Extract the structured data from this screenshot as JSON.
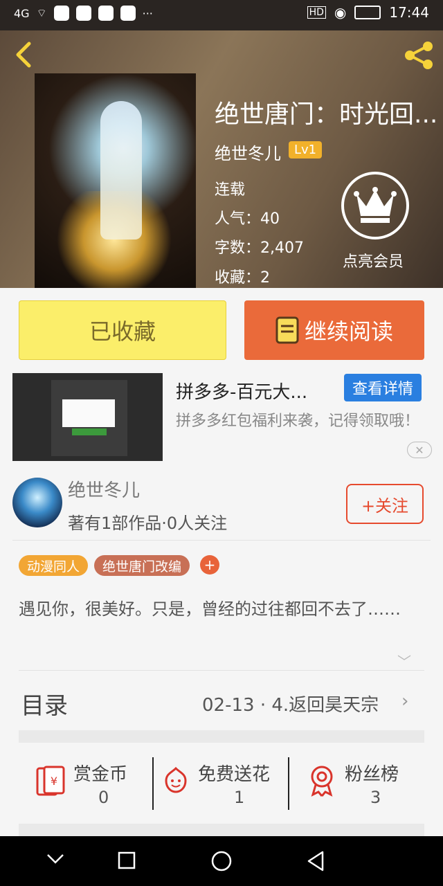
{
  "status_bar": {
    "signal": "4G",
    "time": "17:44",
    "hd": "HD",
    "more": "···"
  },
  "header": {
    "back_icon": "chevron-left-icon",
    "share_icon": "share-icon",
    "title": "绝世唐门：时光回...",
    "author": "绝世冬儿",
    "level": "Lv1",
    "status": "连载",
    "popularity": "人气：40",
    "word_count": "字数：2,407",
    "favorites": "收藏：2",
    "member_label": "点亮会员"
  },
  "actions": {
    "favorited": "已收藏",
    "continue_reading": "继续阅读"
  },
  "ad": {
    "title": "拼多多-百元大...",
    "detail_button": "查看详情",
    "description": "拼多多红包福利来袭，记得领取哦！",
    "close": "✕"
  },
  "author_card": {
    "name": "绝世冬儿",
    "stats": "著有1部作品·0人关注",
    "follow": "+关注"
  },
  "tags": [
    {
      "label": "动漫同人",
      "color": "#f2a634"
    },
    {
      "label": "绝世唐门改编",
      "color": "#c87056"
    }
  ],
  "tag_add": "+",
  "description": "遇见你，很美好。只是，曾经的过往都回不去了……",
  "toc": {
    "label": "目录",
    "latest": "02-13 · 4.返回昊天宗"
  },
  "stats": [
    {
      "label": "赏金币",
      "value": "0",
      "icon": "red-envelope-icon"
    },
    {
      "label": "免费送花",
      "value": "1",
      "icon": "flower-icon"
    },
    {
      "label": "粉丝榜",
      "value": "3",
      "icon": "medal-icon"
    }
  ]
}
